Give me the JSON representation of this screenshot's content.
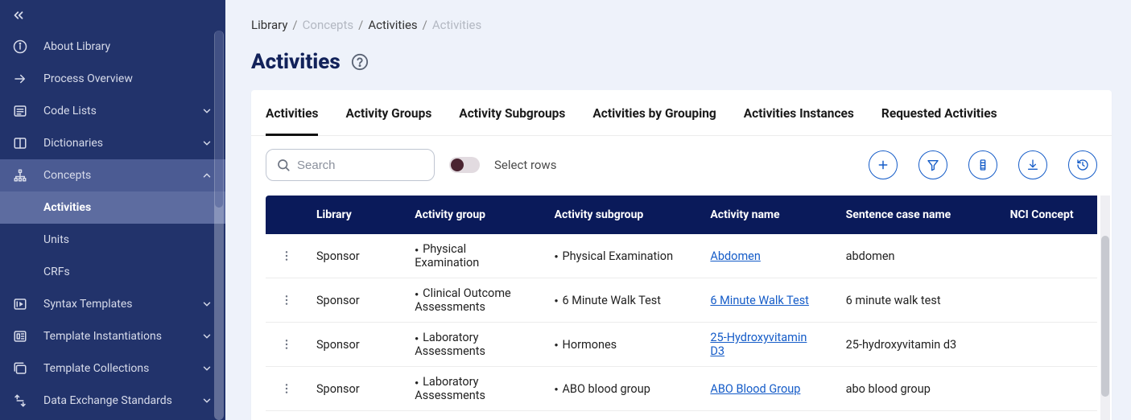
{
  "sidebar": {
    "items": [
      {
        "label": "About Library",
        "icon": "info",
        "expandable": false
      },
      {
        "label": "Process Overview",
        "icon": "arrow-right",
        "expandable": false
      },
      {
        "label": "Code Lists",
        "icon": "list",
        "expandable": true,
        "expanded": false
      },
      {
        "label": "Dictionaries",
        "icon": "book",
        "expandable": true,
        "expanded": false
      },
      {
        "label": "Concepts",
        "icon": "hierarchy",
        "expandable": true,
        "expanded": true,
        "children": [
          {
            "label": "Activities",
            "active": true
          },
          {
            "label": "Units",
            "active": false
          },
          {
            "label": "CRFs",
            "active": false
          }
        ]
      },
      {
        "label": "Syntax Templates",
        "icon": "template",
        "expandable": true,
        "expanded": false
      },
      {
        "label": "Template Instantiations",
        "icon": "instance",
        "expandable": true,
        "expanded": false
      },
      {
        "label": "Template Collections",
        "icon": "collection",
        "expandable": true,
        "expanded": false
      },
      {
        "label": "Data Exchange Standards",
        "icon": "exchange",
        "expandable": true,
        "expanded": false
      }
    ]
  },
  "breadcrumb": {
    "parts": [
      {
        "text": "Library",
        "muted": false
      },
      {
        "text": "Concepts",
        "muted": true
      },
      {
        "text": "Activities",
        "muted": false
      },
      {
        "text": "Activities",
        "muted": true
      }
    ]
  },
  "page": {
    "title": "Activities"
  },
  "tabs": [
    {
      "label": "Activities",
      "active": true
    },
    {
      "label": "Activity Groups",
      "active": false
    },
    {
      "label": "Activity Subgroups",
      "active": false
    },
    {
      "label": "Activities by Grouping",
      "active": false
    },
    {
      "label": "Activities Instances",
      "active": false
    },
    {
      "label": "Requested Activities",
      "active": false
    }
  ],
  "toolbar": {
    "search_placeholder": "Search",
    "select_rows_label": "Select rows"
  },
  "table": {
    "columns": [
      "",
      "Library",
      "Activity group",
      "Activity subgroup",
      "Activity name",
      "Sentence case name",
      "NCI Concept"
    ],
    "rows": [
      {
        "library": "Sponsor",
        "group": "Physical Examination",
        "subgroup": "Physical Examination",
        "name": "Abdomen",
        "sentence": "abdomen"
      },
      {
        "library": "Sponsor",
        "group": "Clinical Outcome Assessments",
        "subgroup": "6 Minute Walk Test",
        "name": "6 Minute Walk Test",
        "sentence": "6 minute walk test"
      },
      {
        "library": "Sponsor",
        "group": "Laboratory Assessments",
        "subgroup": "Hormones",
        "name": "25-Hydroxyvitamin D3",
        "sentence": "25-hydroxyvitamin d3"
      },
      {
        "library": "Sponsor",
        "group": "Laboratory Assessments",
        "subgroup": "ABO blood group",
        "name": "ABO Blood Group",
        "sentence": "abo blood group"
      }
    ]
  }
}
